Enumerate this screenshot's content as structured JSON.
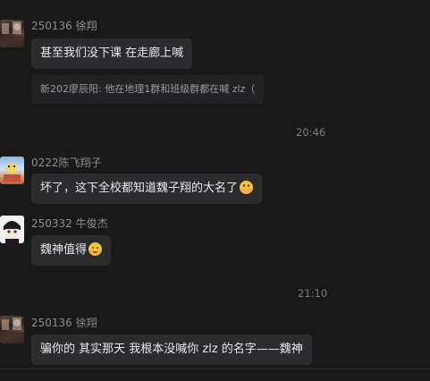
{
  "messages": [
    {
      "sender": "250136 徐翔",
      "text": "甚至我们没下课 在走廊上喊",
      "quote": "新202廖辰阳: 他在地理1群和班级群都在喊 zlz（"
    },
    {
      "sender": "0222陈飞翔子",
      "text": "坏了，这下全校都知道魏子翔的大名了",
      "emoji": "smiling-face-with-hand-over-mouth"
    },
    {
      "sender": "250332 牛俊杰",
      "text": "魏神值得",
      "emoji": "smiling-face"
    },
    {
      "sender": "250136 徐翔",
      "text": "骗你的 其实那天 我根本没喊你 zlz 的名字——魏神"
    }
  ],
  "timestamps": [
    "20:46",
    "21:10"
  ],
  "colors": {
    "background": "#19191a",
    "bubble": "#2c2c2e",
    "text": "#e8e8ea",
    "meta": "#8d8d91"
  }
}
